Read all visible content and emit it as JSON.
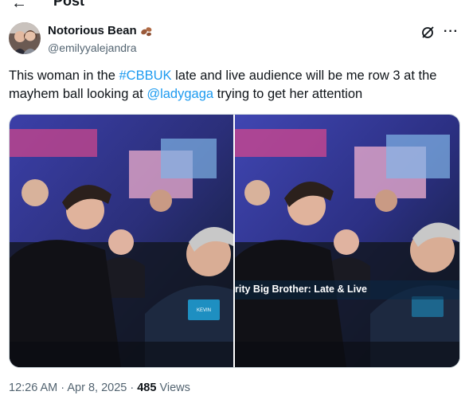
{
  "header": {
    "title": "Post",
    "back_icon": "back-arrow-icon"
  },
  "author": {
    "display_name": "Notorious Bean",
    "handle": "@emilyyalejandra",
    "emoji_icon": "beans-icon"
  },
  "actions": {
    "grok_icon": "grok-icon",
    "more_icon": "more-dots-icon",
    "more_glyph": "···"
  },
  "tweet": {
    "part1": "This woman in the ",
    "hashtag": "#CBBUK",
    "part2": " late and live audience will be me row 3 at the mayhem ball looking at ",
    "mention": "@ladygaga",
    "part3": " trying to get her attention"
  },
  "media": {
    "photo_right_caption": "rity Big Brother: Late & Live",
    "name_badge": "KEVIN"
  },
  "meta": {
    "time": "12:26 AM",
    "separator": " · ",
    "date": "Apr 8, 2025",
    "views_count": "485",
    "views_label": " Views"
  },
  "colors": {
    "accent": "#1d9bf0",
    "muted": "#536471",
    "text": "#0f1419"
  }
}
